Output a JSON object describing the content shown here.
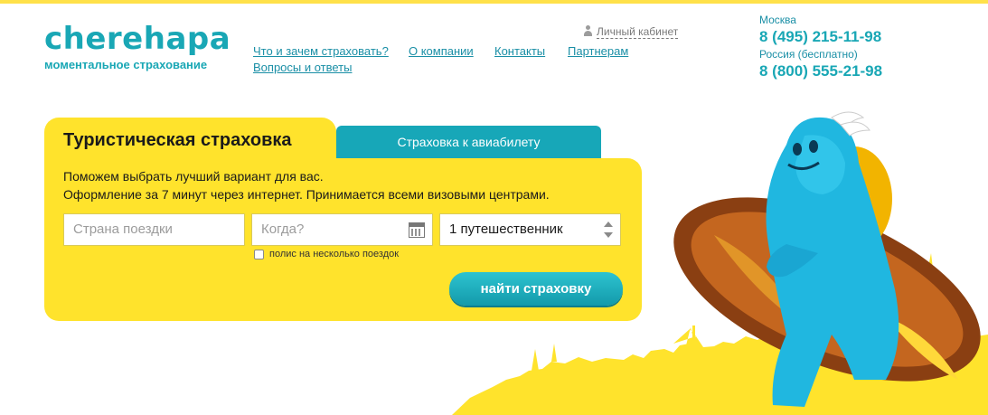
{
  "brand": {
    "logo": "cherehapa",
    "tagline": "моментальное страхование",
    "accent_color": "#19a7b5",
    "yellow_color": "#ffe32c"
  },
  "nav": {
    "items": [
      "Что и зачем страховать?",
      "О компании",
      "Контакты",
      "Партнерам",
      "Вопросы и ответы"
    ]
  },
  "account": {
    "icon": "user-icon",
    "label": "Личный кабинет"
  },
  "contacts": {
    "city_1": "Москва",
    "phone_1": "8 (495) 215-11-98",
    "city_2": "Россия (бесплатно)",
    "phone_2": "8 (800) 555-21-98"
  },
  "tabs": {
    "active": "Туристическая страховка",
    "inactive": "Страховка к авиабилету"
  },
  "form": {
    "intro_line_1": "Поможем выбрать лучший вариант для вас.",
    "intro_line_2": "Оформление за 7 минут через интернет. Принимается всеми визовыми центрами.",
    "country_placeholder": "Страна поездки",
    "when_placeholder": "Когда?",
    "travelers_value": "1 путешественник",
    "multi_trip_label": "полис на несколько поездок",
    "multi_trip_checked": false,
    "submit_label": "найти страховку"
  }
}
